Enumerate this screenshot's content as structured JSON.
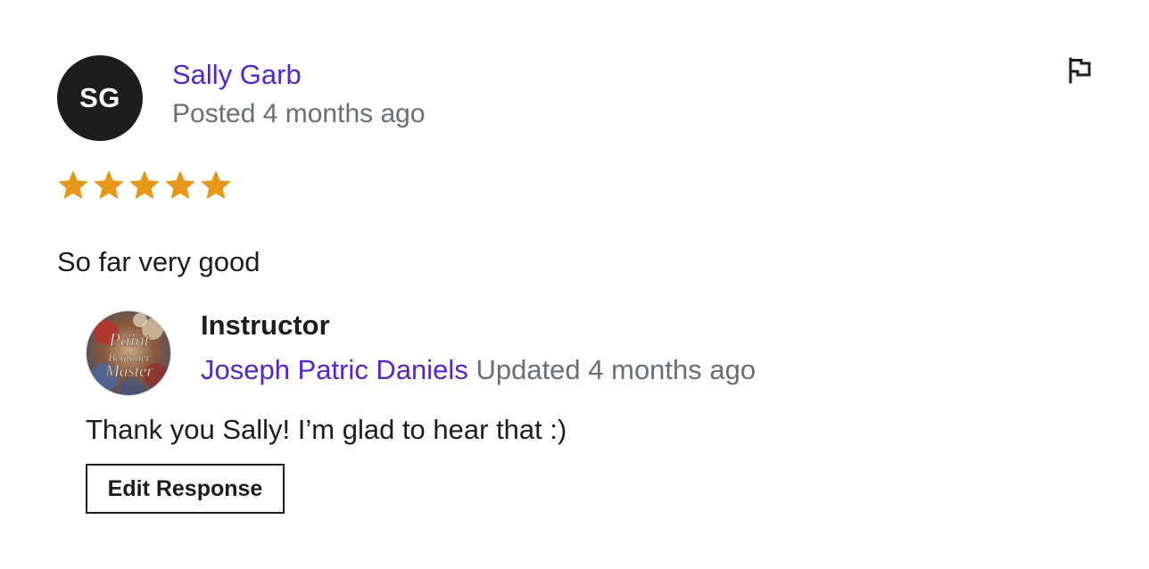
{
  "review": {
    "avatar_initials": "SG",
    "reviewer_name": "Sally Garb",
    "posted_text": "Posted 4 months ago",
    "rating": 5,
    "rating_max": 5,
    "star_color": "#e59819",
    "comment": "So far very good",
    "flag_icon": "flag-icon"
  },
  "response": {
    "label": "Instructor",
    "instructor_name": "Joseph Patric Daniels",
    "updated_text": "Updated 4 months ago",
    "avatar_logo_text": [
      "Paint",
      "Beginner",
      "Master"
    ],
    "text": "Thank you Sally! I’m glad to hear that :)",
    "edit_button_label": "Edit Response"
  },
  "colors": {
    "link": "#5624d0",
    "muted": "#6a6f73",
    "text": "#1c1d1f"
  }
}
